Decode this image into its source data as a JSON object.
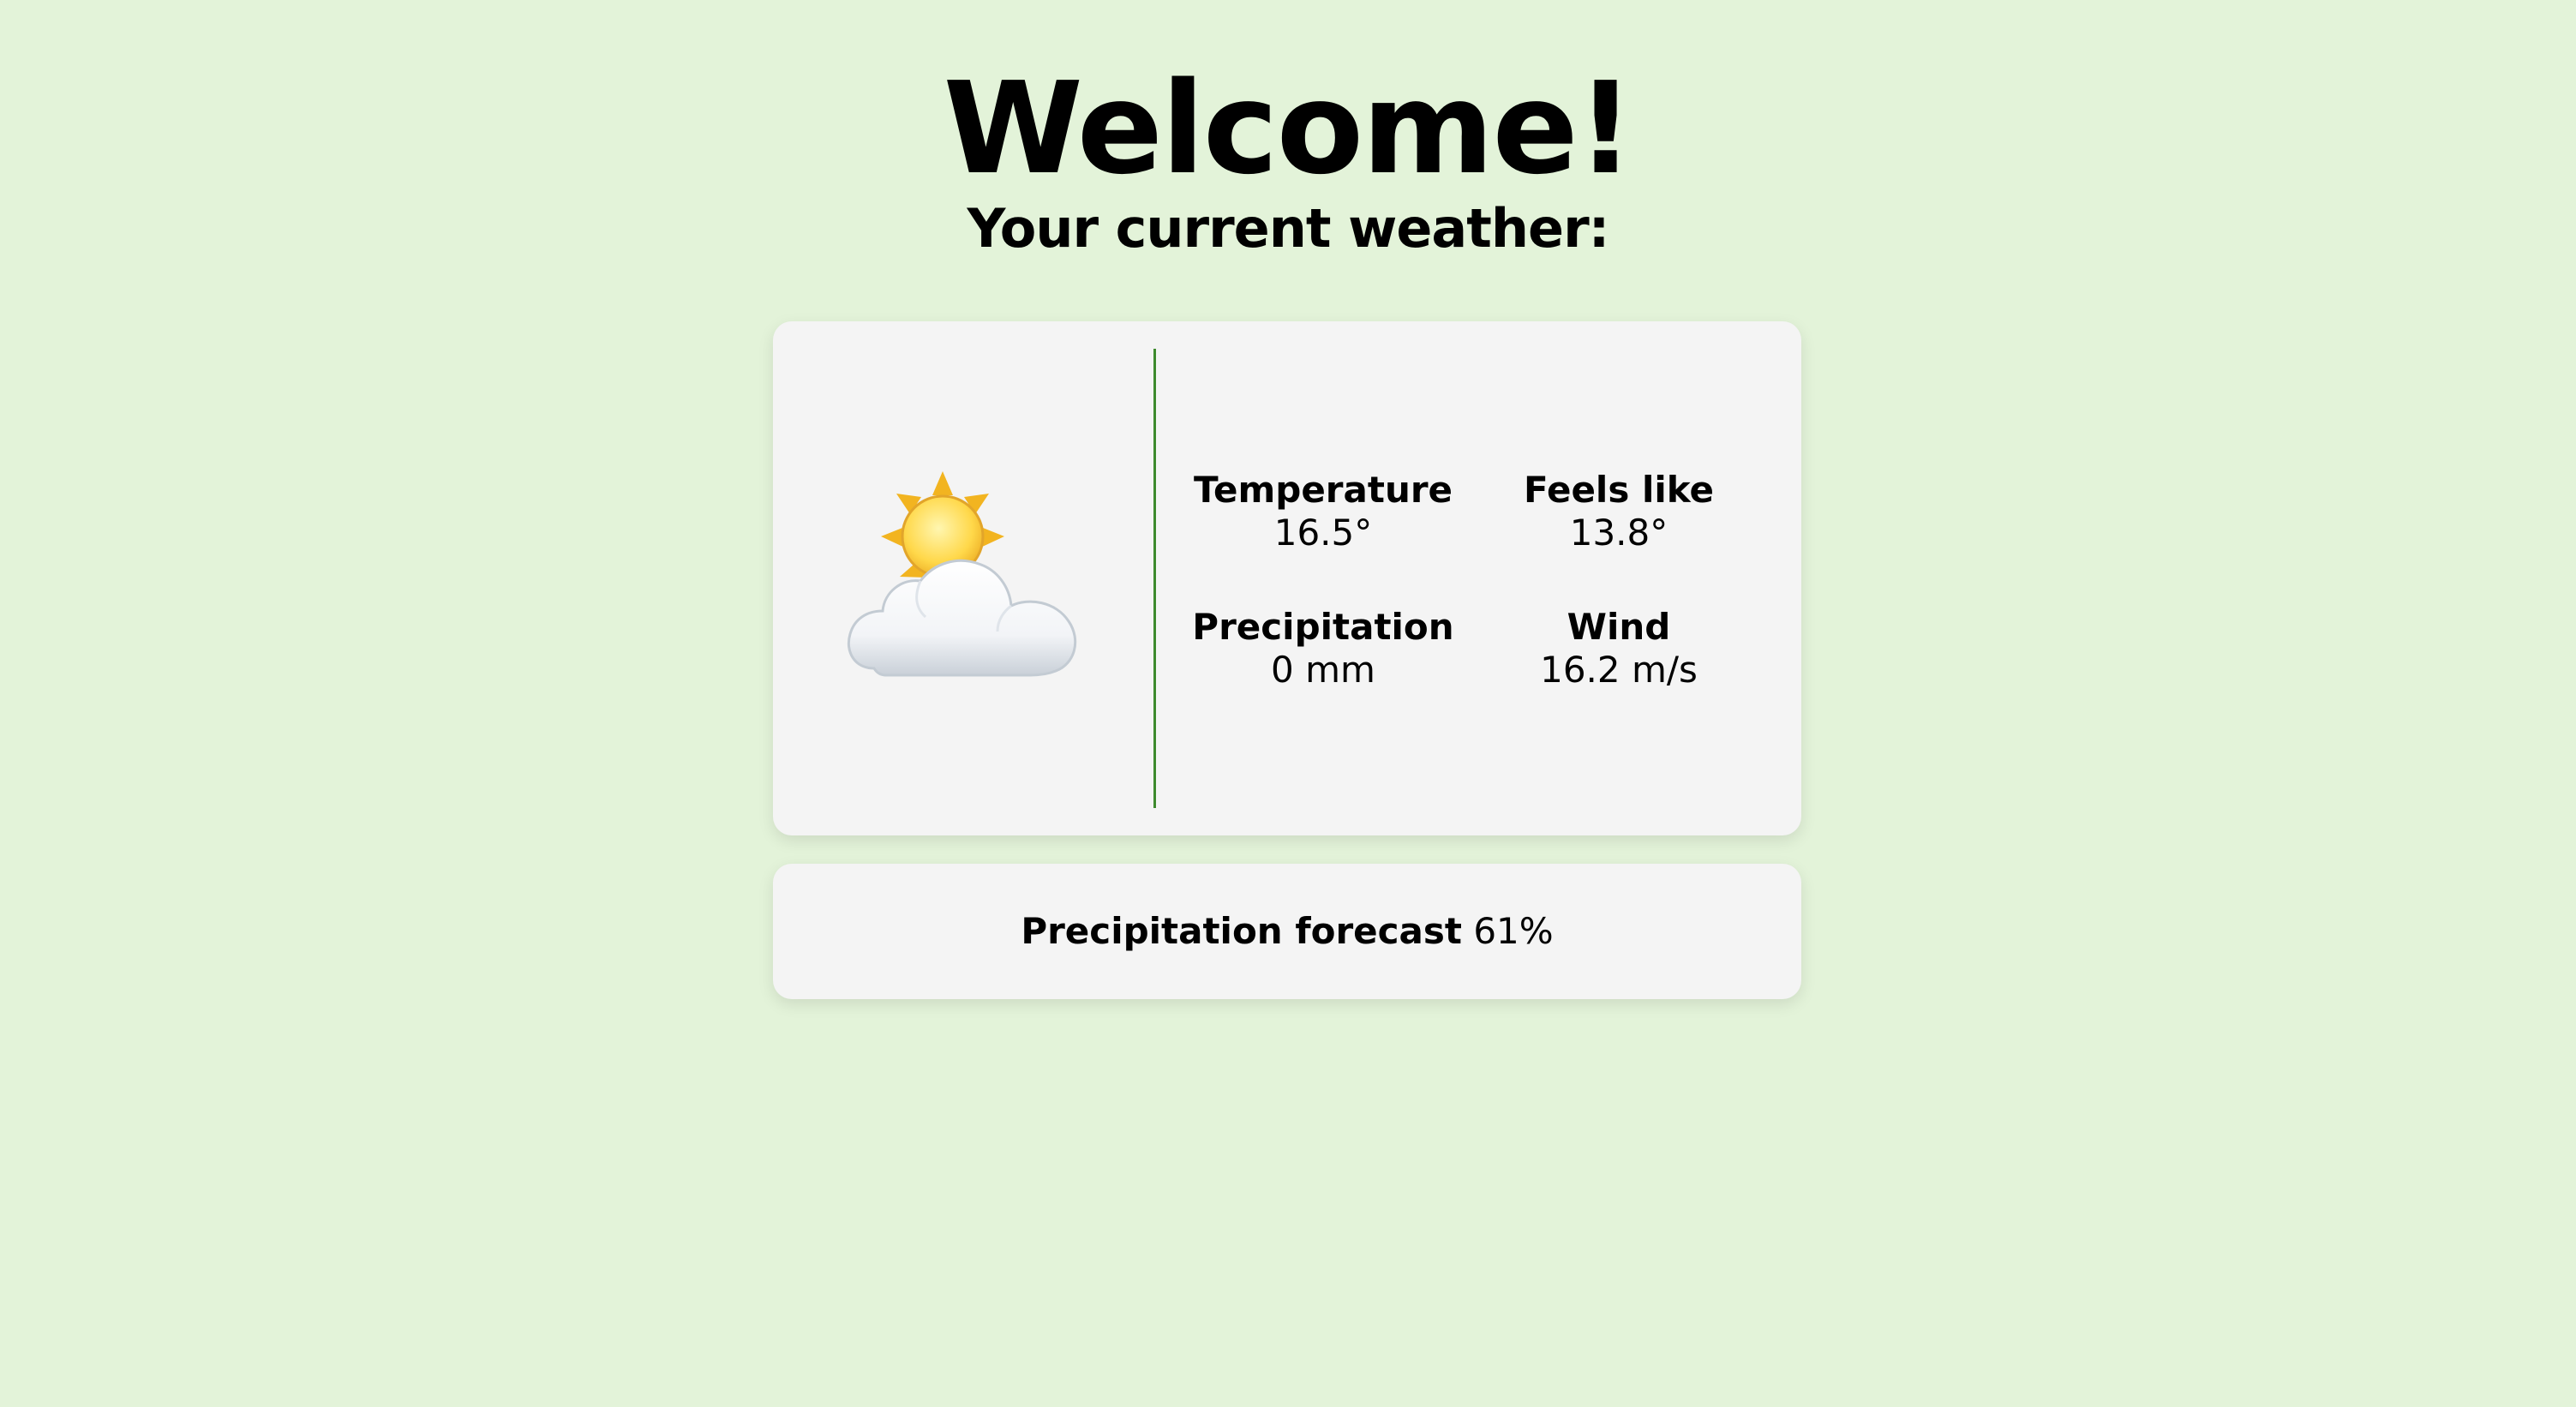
{
  "header": {
    "title": "Welcome!",
    "subtitle": "Your current weather:"
  },
  "weather": {
    "icon": "sun-behind-cloud-icon",
    "temperature": {
      "label": "Temperature",
      "value": "16.5°"
    },
    "feels_like": {
      "label": "Feels like",
      "value": "13.8°"
    },
    "precipitation": {
      "label": "Precipitation",
      "value": "0 mm"
    },
    "wind": {
      "label": "Wind",
      "value": "16.2 m/s"
    }
  },
  "forecast": {
    "label": "Precipitation forecast",
    "value": "61%"
  },
  "colors": {
    "background": "#e3f3d9",
    "card": "#f4f4f4",
    "divider": "#3d8a2d"
  }
}
